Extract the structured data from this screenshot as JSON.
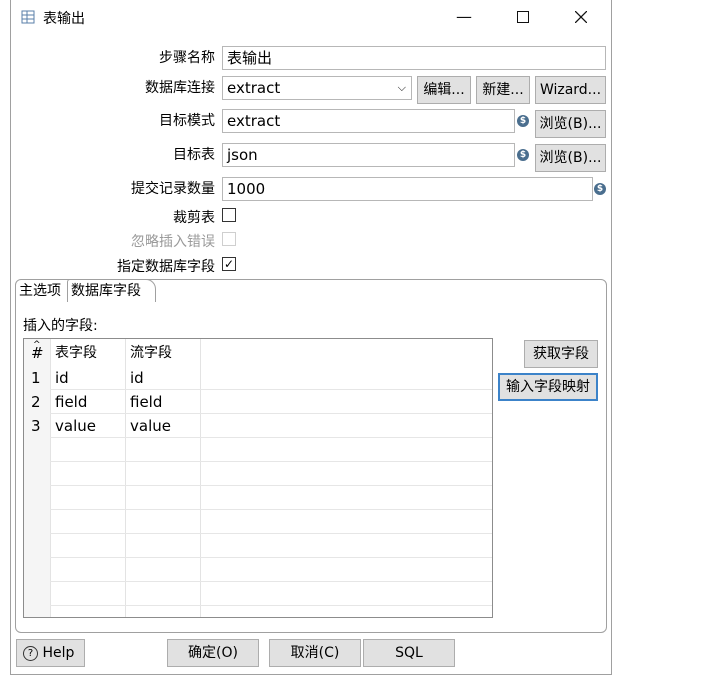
{
  "window": {
    "title": "表输出"
  },
  "form": {
    "step_name_label": "步骤名称",
    "step_name_value": "表输出",
    "db_conn_label": "数据库连接",
    "db_conn_value": "extract",
    "edit_button": "编辑...",
    "new_button": "新建...",
    "wizard_button": "Wizard...",
    "schema_label": "目标模式",
    "schema_value": "extract",
    "browse_schema_button": "浏览(B)...",
    "table_label": "目标表",
    "table_value": "json",
    "browse_table_button": "浏览(B)...",
    "commit_size_label": "提交记录数量",
    "commit_size_value": "1000",
    "truncate_label": "裁剪表",
    "truncate_checked": false,
    "ignore_errors_label": "忽略插入错误",
    "ignore_errors_checked": false,
    "specify_fields_label": "指定数据库字段",
    "specify_fields_checked": true,
    "check_mark": "✓",
    "variable_icon_glyph": "$"
  },
  "tabs": [
    {
      "label": "主选项",
      "active": false
    },
    {
      "label": "数据库字段",
      "active": true
    }
  ],
  "fields_panel": {
    "insert_fields_label": "插入的字段:",
    "columns": [
      "#",
      "表字段",
      "流字段"
    ],
    "rows": [
      {
        "num": "1",
        "table_field": "id",
        "stream_field": "id"
      },
      {
        "num": "2",
        "table_field": "field",
        "stream_field": "field"
      },
      {
        "num": "3",
        "table_field": "value",
        "stream_field": "value"
      }
    ],
    "get_fields_button": "获取字段",
    "input_mapping_button": "输入字段映射"
  },
  "footer": {
    "help_button": "Help",
    "ok_button": "确定(O)",
    "cancel_button": "取消(C)",
    "sql_button": "SQL"
  },
  "colors": {
    "focus_border": "#3c83c9",
    "button_bg": "#e1e1e1",
    "variable_icon": "#4a6e8e"
  }
}
